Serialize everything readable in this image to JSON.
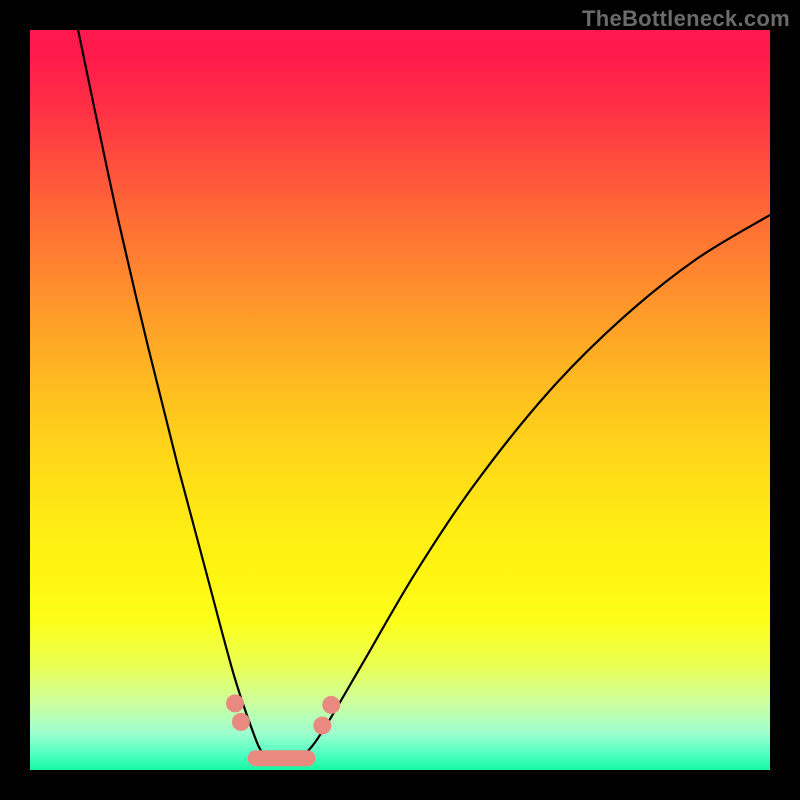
{
  "attribution": "TheBottleneck.com",
  "chart_data": {
    "type": "line",
    "title": "",
    "xlabel": "",
    "ylabel": "",
    "xlim": [
      0,
      1
    ],
    "ylim": [
      0,
      100
    ],
    "curve": {
      "comment": "Single V-shaped curve; x is normalized horizontal position inside the plot, y is percent (0=bottom green, 100=top red). Valley near x≈0.33.",
      "points": [
        {
          "x": 0.065,
          "y": 100.0
        },
        {
          "x": 0.09,
          "y": 88.0
        },
        {
          "x": 0.12,
          "y": 74.0
        },
        {
          "x": 0.16,
          "y": 57.0
        },
        {
          "x": 0.2,
          "y": 41.0
        },
        {
          "x": 0.24,
          "y": 26.0
        },
        {
          "x": 0.275,
          "y": 13.0
        },
        {
          "x": 0.3,
          "y": 5.5
        },
        {
          "x": 0.315,
          "y": 2.2
        },
        {
          "x": 0.335,
          "y": 1.2
        },
        {
          "x": 0.355,
          "y": 1.2
        },
        {
          "x": 0.375,
          "y": 2.5
        },
        {
          "x": 0.4,
          "y": 6.0
        },
        {
          "x": 0.45,
          "y": 14.5
        },
        {
          "x": 0.52,
          "y": 26.5
        },
        {
          "x": 0.6,
          "y": 38.5
        },
        {
          "x": 0.7,
          "y": 51.0
        },
        {
          "x": 0.8,
          "y": 61.0
        },
        {
          "x": 0.9,
          "y": 69.0
        },
        {
          "x": 1.0,
          "y": 75.0
        }
      ]
    },
    "valley_markers": {
      "comment": "Pink rounded markers/segment overlaid at the valley bottom.",
      "dots": [
        {
          "x": 0.277,
          "y": 9.0
        },
        {
          "x": 0.285,
          "y": 6.5
        },
        {
          "x": 0.395,
          "y": 6.0
        },
        {
          "x": 0.407,
          "y": 8.8
        }
      ],
      "flat_segment": {
        "x1": 0.305,
        "x2": 0.375,
        "y": 1.6
      }
    }
  }
}
